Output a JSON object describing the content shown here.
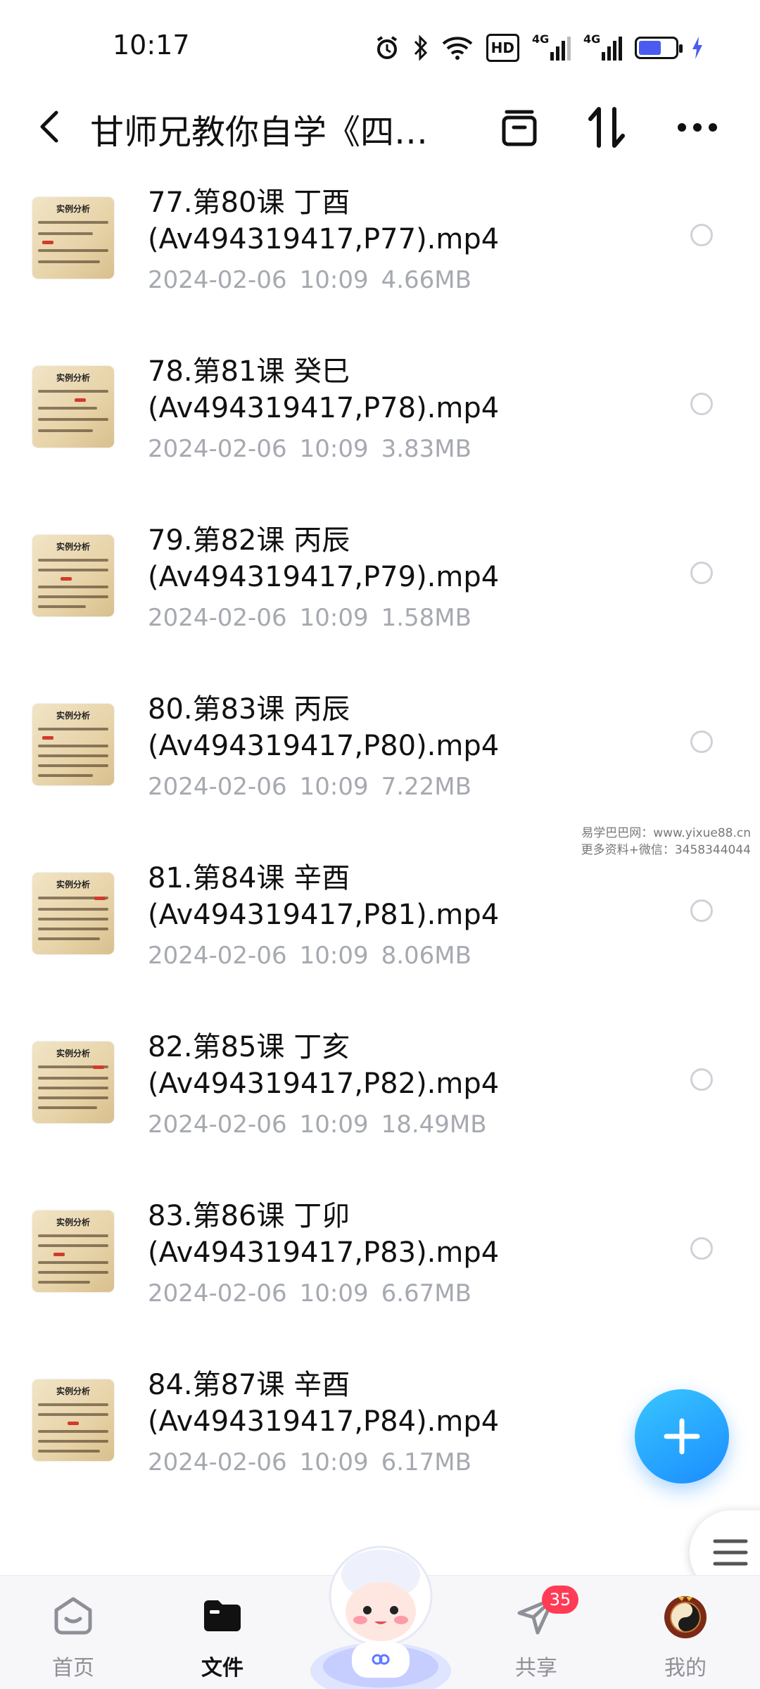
{
  "status_bar": {
    "time": "10:17",
    "icons": [
      "alarm-icon",
      "bluetooth-icon",
      "wifi-icon",
      "hd-icon",
      "signal-4g-icon",
      "signal-4g-icon",
      "battery-icon",
      "charging-icon"
    ],
    "hd_label": "HD",
    "network_label_1": "4G",
    "network_label_2": "4G"
  },
  "header": {
    "title": "甘师兄教你自学《四…",
    "icons": [
      "back-icon",
      "archive-icon",
      "sort-icon",
      "more-icon"
    ]
  },
  "files": [
    {
      "name_line1": "77.第80课 丁酉",
      "name_line2": "(Av494319417,P77).mp4",
      "date": "2024-02-06",
      "time": "10:09",
      "size": "4.66MB",
      "thumb_title": "实例分析"
    },
    {
      "name_line1": "78.第81课 癸巳",
      "name_line2": "(Av494319417,P78).mp4",
      "date": "2024-02-06",
      "time": "10:09",
      "size": "3.83MB",
      "thumb_title": "实例分析"
    },
    {
      "name_line1": "79.第82课 丙辰",
      "name_line2": "(Av494319417,P79).mp4",
      "date": "2024-02-06",
      "time": "10:09",
      "size": "1.58MB",
      "thumb_title": "实例分析"
    },
    {
      "name_line1": "80.第83课 丙辰",
      "name_line2": "(Av494319417,P80).mp4",
      "date": "2024-02-06",
      "time": "10:09",
      "size": "7.22MB",
      "thumb_title": "实例分析"
    },
    {
      "name_line1": "81.第84课 辛酉",
      "name_line2": "(Av494319417,P81).mp4",
      "date": "2024-02-06",
      "time": "10:09",
      "size": "8.06MB",
      "thumb_title": "实例分析"
    },
    {
      "name_line1": "82.第85课 丁亥",
      "name_line2": "(Av494319417,P82).mp4",
      "date": "2024-02-06",
      "time": "10:09",
      "size": "18.49MB",
      "thumb_title": "实例分析"
    },
    {
      "name_line1": "83.第86课 丁卯",
      "name_line2": "(Av494319417,P83).mp4",
      "date": "2024-02-06",
      "time": "10:09",
      "size": "6.67MB",
      "thumb_title": "实例分析"
    },
    {
      "name_line1": "84.第87课 辛酉",
      "name_line2": "(Av494319417,P84).mp4",
      "date": "2024-02-06",
      "time": "10:09",
      "size": "6.17MB",
      "thumb_title": "实例分析"
    }
  ],
  "watermark": {
    "line1": "易学巴巴网：www.yixue88.cn",
    "line2": "更多资料+微信：3458344044"
  },
  "fab": {
    "icon": "plus-icon"
  },
  "side_menu": {
    "icon": "menu-icon"
  },
  "bottom_nav": {
    "items": [
      {
        "label": "首页",
        "icon": "home-icon",
        "active": false
      },
      {
        "label": "文件",
        "icon": "folder-icon",
        "active": true
      },
      {
        "label": "共享",
        "icon": "share-icon",
        "active": false,
        "badge": "35"
      },
      {
        "label": "我的",
        "icon": "profile-avatar-icon",
        "active": false
      }
    ],
    "center_icon": "mascot-icon"
  },
  "colors": {
    "accent": "#1a8cff",
    "meta_text": "#a6a9b0",
    "badge": "#ff3b55",
    "battery_fill": "#4a5cf0"
  }
}
